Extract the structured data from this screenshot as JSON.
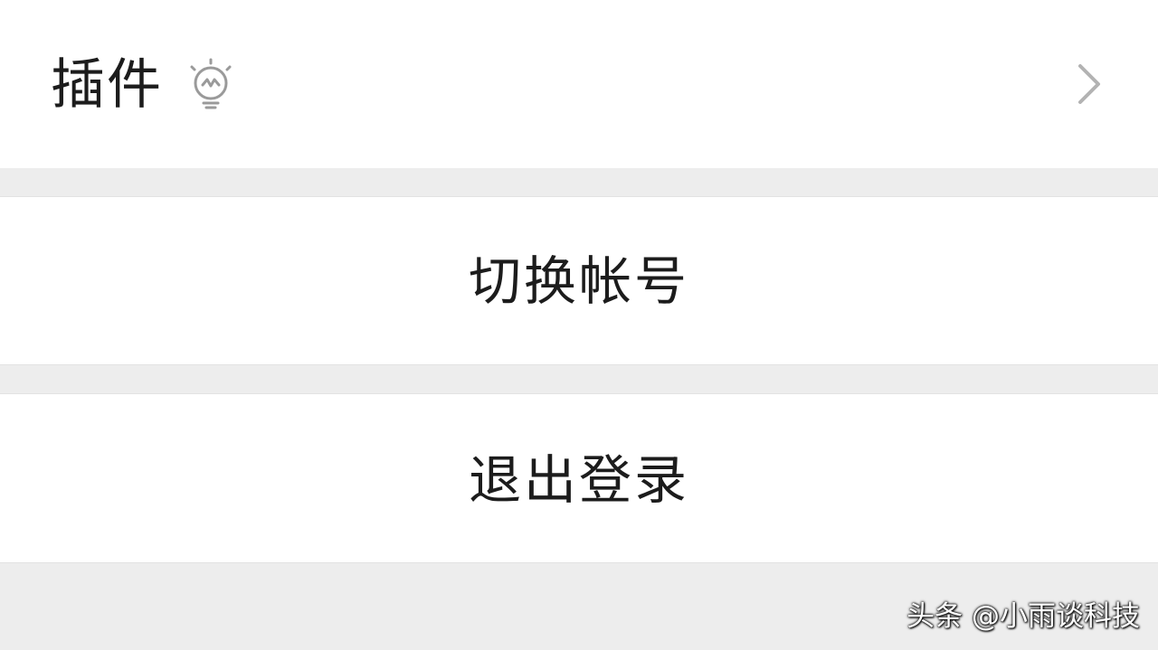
{
  "menu": {
    "plugins": {
      "label": "插件",
      "icon": "lightbulb-icon",
      "arrow_icon": "chevron-right-icon"
    },
    "switch_account": {
      "label": "切换帐号"
    },
    "logout": {
      "label": "退出登录"
    }
  },
  "watermark": {
    "text": "头条 @小雨谈科技"
  },
  "colors": {
    "background": "#ededed",
    "row_background": "#ffffff",
    "text": "#1c1c1c",
    "icon_gray": "#9a9a9a",
    "chevron_gray": "#b3b3b3"
  }
}
